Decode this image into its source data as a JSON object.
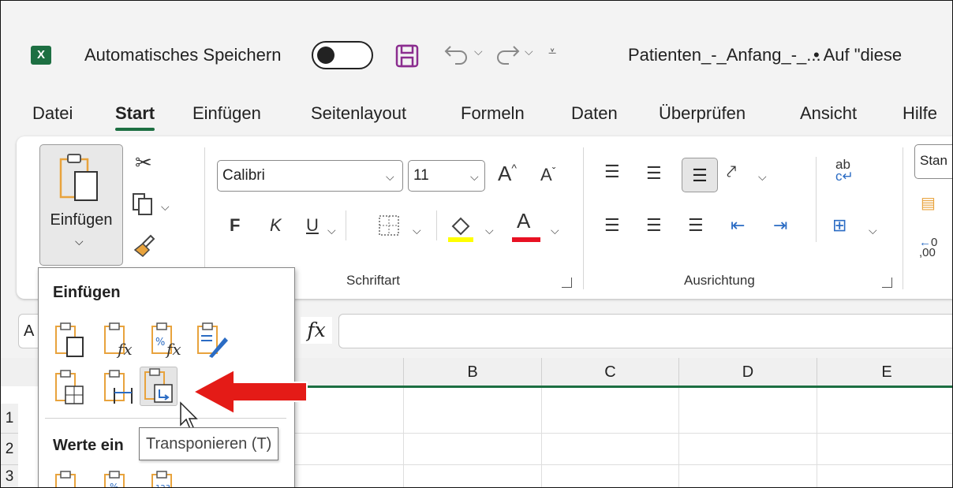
{
  "titlebar": {
    "logo_text": "X",
    "autosave_label": "Automatisches Speichern",
    "filename": "Patienten_-_Anfang_-_...",
    "location": "• Auf \"diese"
  },
  "menu": {
    "items": [
      "Datei",
      "Start",
      "Einfügen",
      "Seitenlayout",
      "Formeln",
      "Daten",
      "Überprüfen",
      "Ansicht",
      "Hilfe"
    ],
    "active": "Start"
  },
  "ribbon": {
    "paste_label": "Einfügen",
    "font_name": "Calibri",
    "font_size": "11",
    "bold": "F",
    "italic": "K",
    "underline": "U",
    "font_color_letter": "A",
    "grow_font": "A",
    "shrink_font": "A",
    "wrap_text": "ab",
    "number_format": "Stan",
    "decimal_label": ",00",
    "font_group_label": "Schriftart",
    "alignment_group_label": "Ausrichtung",
    "colors": {
      "highlight": "#ffff00",
      "font_color": "#e81123",
      "accent": "#1d6f42"
    }
  },
  "formula_bar": {
    "name_box": "A",
    "fx_label": "fx",
    "value": ""
  },
  "sheet": {
    "columns": [
      "B",
      "C",
      "D",
      "E"
    ],
    "rows": [
      "1",
      "2",
      "3"
    ]
  },
  "paste_menu": {
    "heading": "Einfügen",
    "values_heading": "Werte ein",
    "tooltip": "Transponieren (T)",
    "icons_row1": [
      "paste-icon",
      "paste-formulas-icon",
      "paste-formulas-number-format-icon",
      "paste-keep-source-formatting-icon"
    ],
    "icons_row2": [
      "paste-no-borders-icon",
      "paste-keep-column-widths-icon",
      "transpose-icon"
    ],
    "icons_row3": [
      "paste-values-icon",
      "paste-values-number-format-icon",
      "paste-values-source-formatting-icon"
    ]
  }
}
